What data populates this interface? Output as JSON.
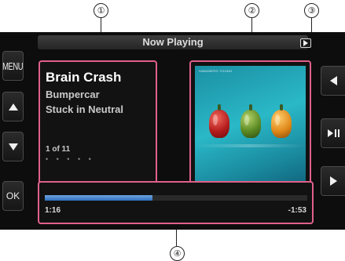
{
  "callouts": {
    "c1": "①",
    "c2": "②",
    "c3": "③",
    "c4": "④"
  },
  "header": {
    "title": "Now Playing"
  },
  "left_buttons": {
    "menu": "MENU",
    "ok": "OK"
  },
  "track": {
    "title": "Brain Crash",
    "artist": "Bumpercar",
    "album": "Stuck in Neutral",
    "position": "1 of 11",
    "dots": "• • • • •"
  },
  "artwork": {
    "caption": "HABANERO YOUNG"
  },
  "progress": {
    "elapsed": "1:16",
    "remaining": "-1:53",
    "fraction": 0.41
  },
  "icons": {
    "up": "up-arrow-icon",
    "down": "down-arrow-icon",
    "prev": "previous-track-icon",
    "play_pause": "play-pause-icon",
    "next": "next-track-icon",
    "play_state": "play-state-icon"
  },
  "colors": {
    "highlight": "#e0608a",
    "progress": "#2e6fbf",
    "background": "#0d0d0d"
  }
}
